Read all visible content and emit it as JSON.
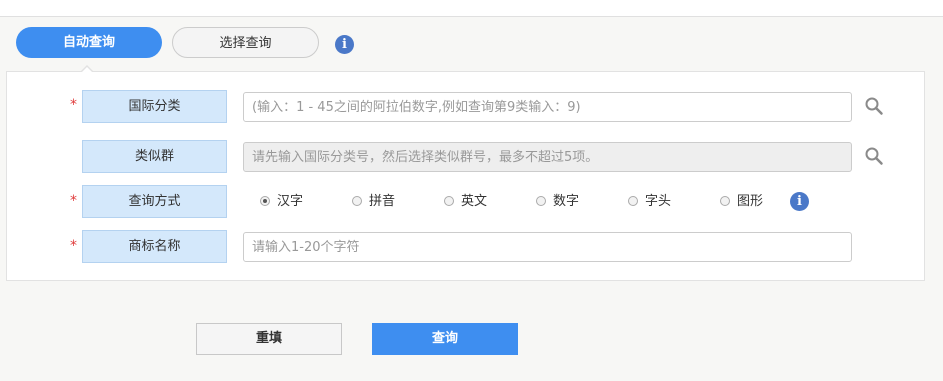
{
  "tabs": {
    "auto": "自动查询",
    "select": "选择查询",
    "info_symbol": "i"
  },
  "form": {
    "required_mark": "*",
    "intl_class": {
      "label": "国际分类",
      "placeholder": "(输入：1 - 45之间的阿拉伯数字,例如查询第9类输入：9)"
    },
    "similar_group": {
      "label": "类似群",
      "placeholder": "请先输入国际分类号，然后选择类似群号，最多不超过5项。"
    },
    "query_method": {
      "label": "查询方式",
      "options": [
        "汉字",
        "拼音",
        "英文",
        "数字",
        "字头",
        "图形"
      ],
      "selected": "汉字"
    },
    "trademark_name": {
      "label": "商标名称",
      "placeholder": "请输入1-20个字符"
    }
  },
  "buttons": {
    "reset": "重填",
    "query": "查询"
  },
  "icons": {
    "info": "info-icon",
    "search": "magnifier-search-icon"
  },
  "colors": {
    "accent": "#3e8ef0",
    "label_bg": "#d4e8fb",
    "info": "#4a78c8",
    "required": "#e03b3b"
  }
}
